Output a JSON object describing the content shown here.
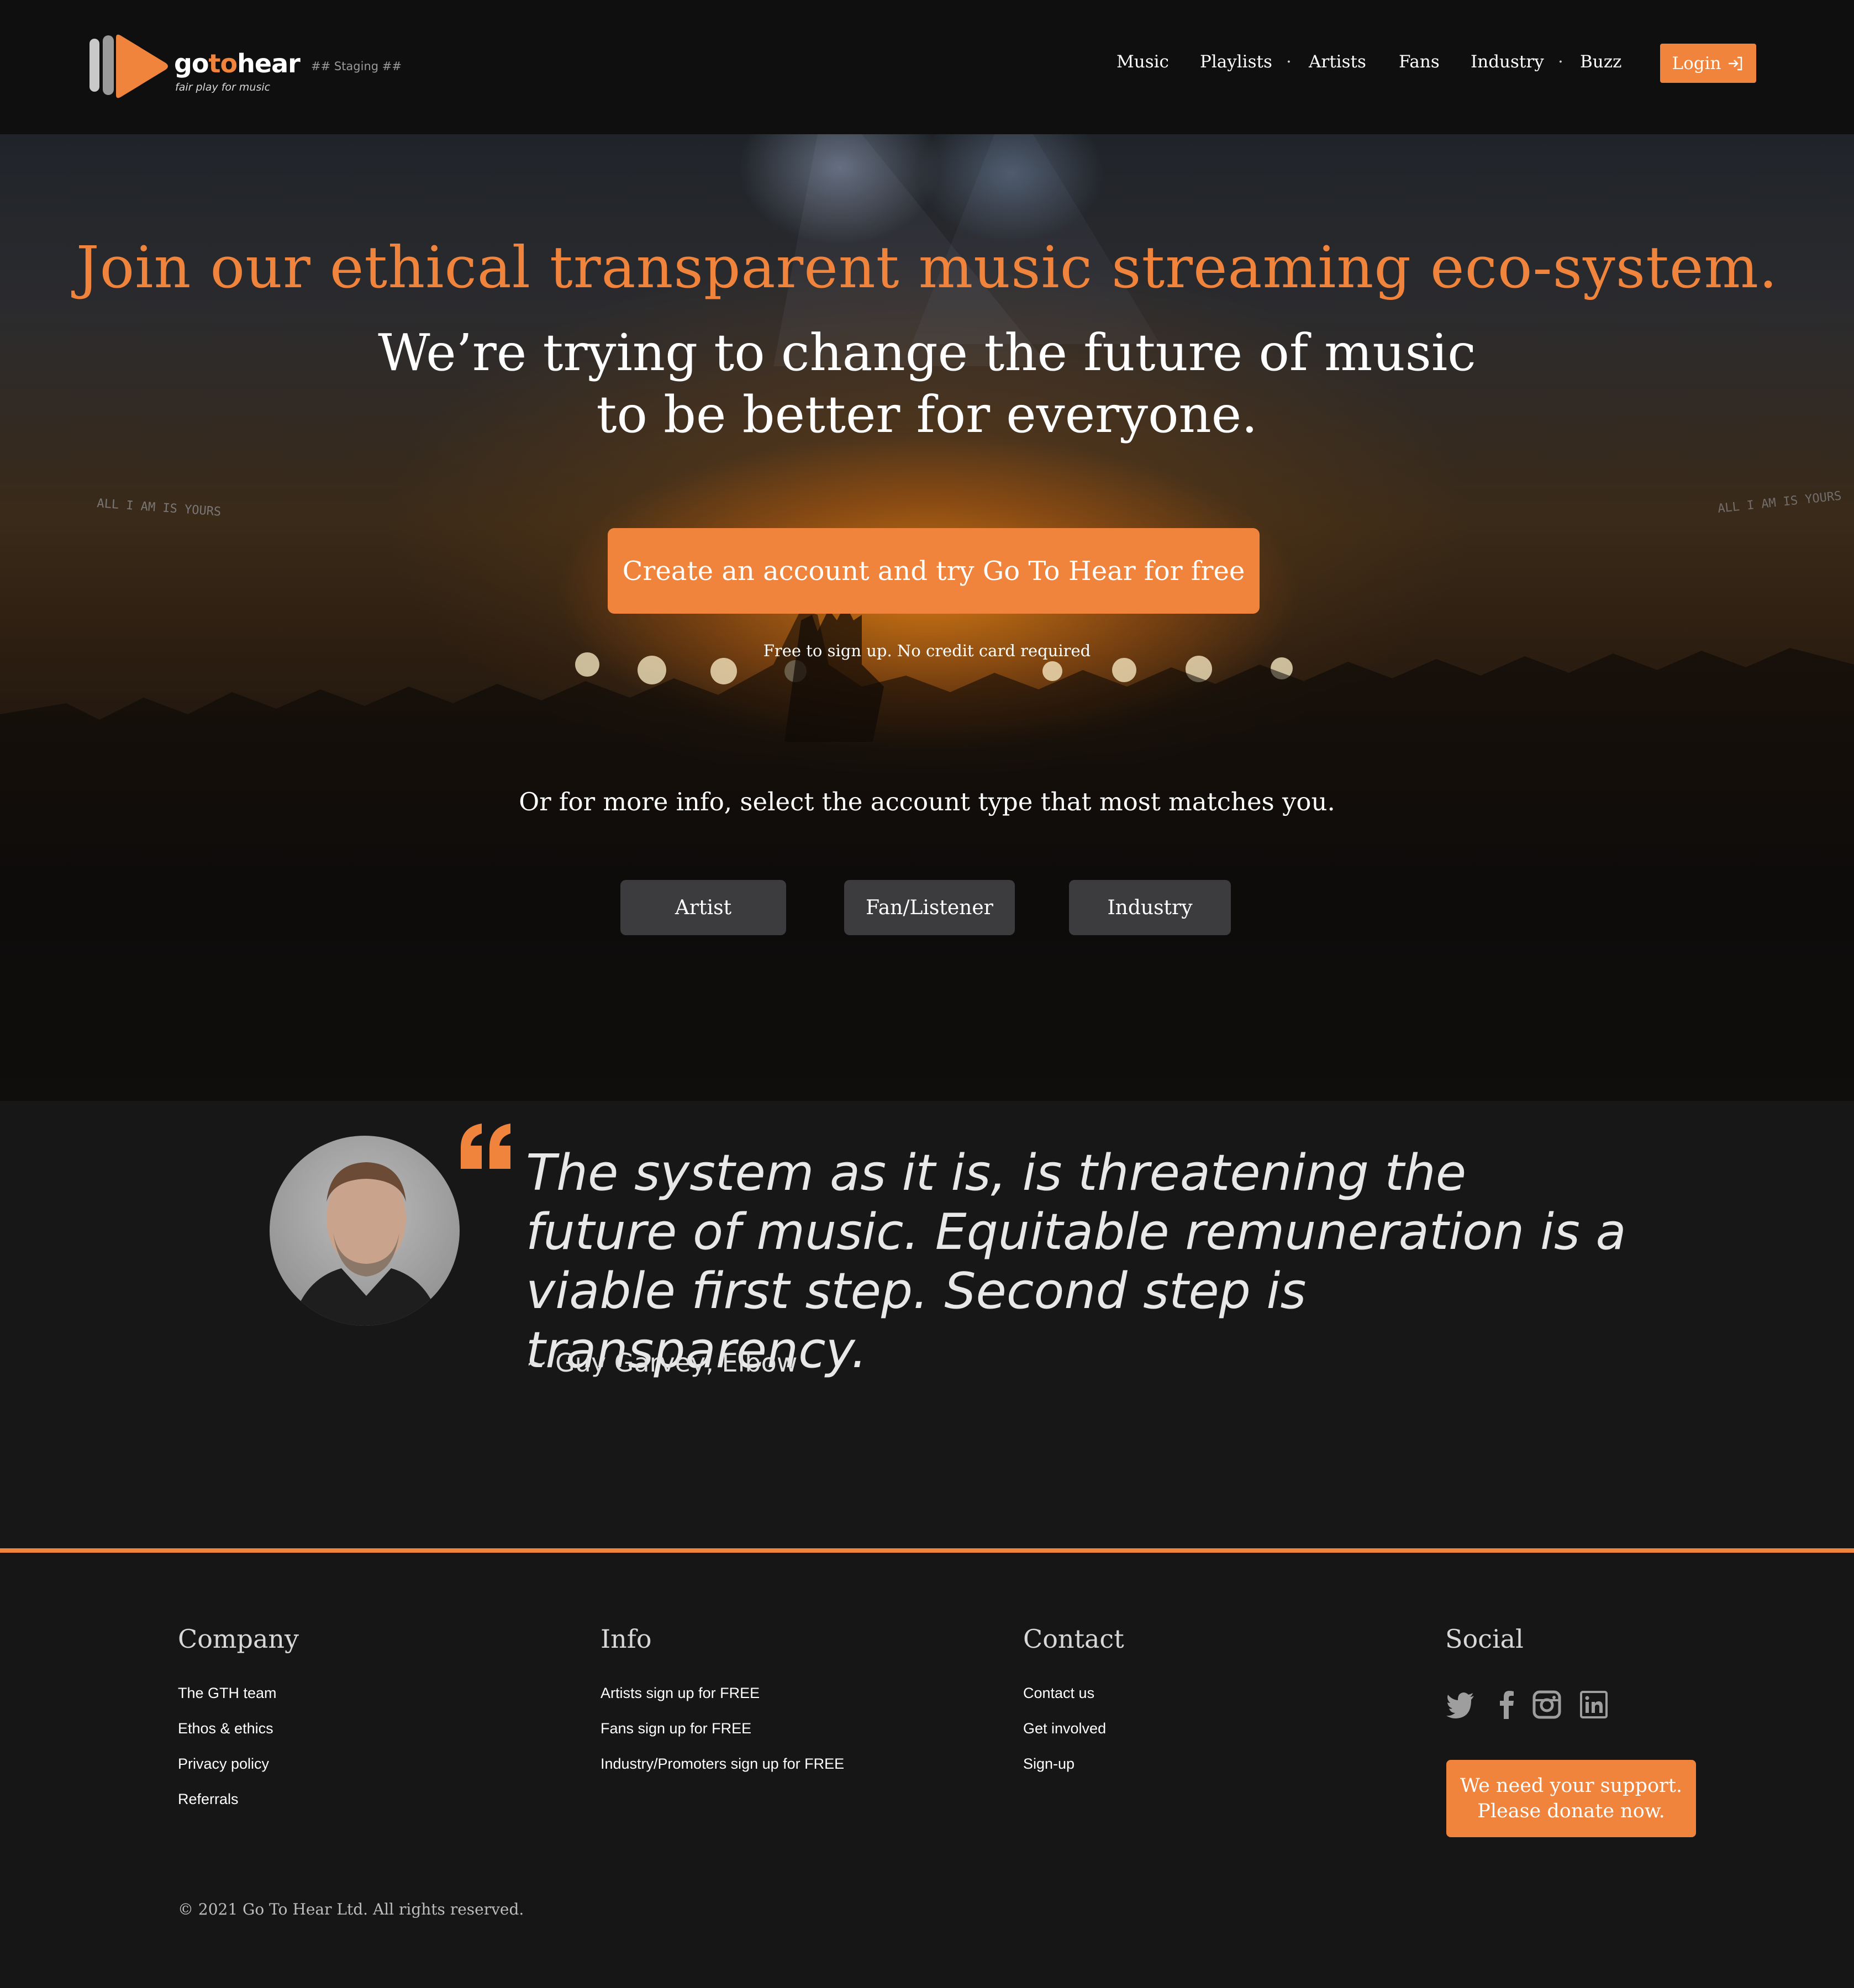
{
  "header": {
    "brand": {
      "go": "go",
      "to": "to",
      "hear": "hear",
      "tagline": "fair play for music"
    },
    "staging_label": "## Staging ##",
    "nav": {
      "music": "Music",
      "playlists": "Playlists",
      "artists": "Artists",
      "fans": "Fans",
      "industry": "Industry",
      "buzz": "Buzz",
      "separator": "·"
    },
    "login_label": "Login"
  },
  "hero": {
    "headline": "Join our ethical transparent music streaming eco-system.",
    "subheadline_line1": "We’re trying to change the future of music",
    "subheadline_line2": "to be better for everyone.",
    "cta_label": "Create an account and try Go To Hear for free",
    "cta_note": "Free to sign up. No credit card required",
    "more_info": "Or for more info, select the account type that most matches you.",
    "account_types": {
      "artist": "Artist",
      "fan": "Fan/Listener",
      "industry": "Industry"
    },
    "banner_text_left": "ALL I AM IS YOURS",
    "banner_text_right": "ALL I AM IS YOURS"
  },
  "testimonial": {
    "quote": "The system as it is, is threatening the future of music. Equitable remuneration is a viable first step. Second step is transparency.",
    "author": "~ Guy Garvey, Elbow"
  },
  "footer": {
    "company": {
      "title": "Company",
      "links": [
        "The GTH team",
        "Ethos & ethics",
        "Privacy policy",
        "Referrals"
      ]
    },
    "info": {
      "title": "Info",
      "links": [
        "Artists sign up for FREE",
        "Fans sign up for FREE",
        "Industry/Promoters sign up for FREE"
      ]
    },
    "contact": {
      "title": "Contact",
      "links": [
        "Contact us",
        "Get involved",
        "Sign-up"
      ]
    },
    "social": {
      "title": "Social",
      "icons": [
        "twitter-icon",
        "facebook-icon",
        "instagram-icon",
        "linkedin-icon"
      ]
    },
    "donate_line1": "We need your support.",
    "donate_line2": "Please donate now.",
    "copyright": "© 2021 Go To Hear Ltd. All rights reserved."
  },
  "colors": {
    "accent": "#f0843c",
    "background": "#171717",
    "header": "#0f0f0f",
    "button_dark": "#3c3c3e"
  }
}
